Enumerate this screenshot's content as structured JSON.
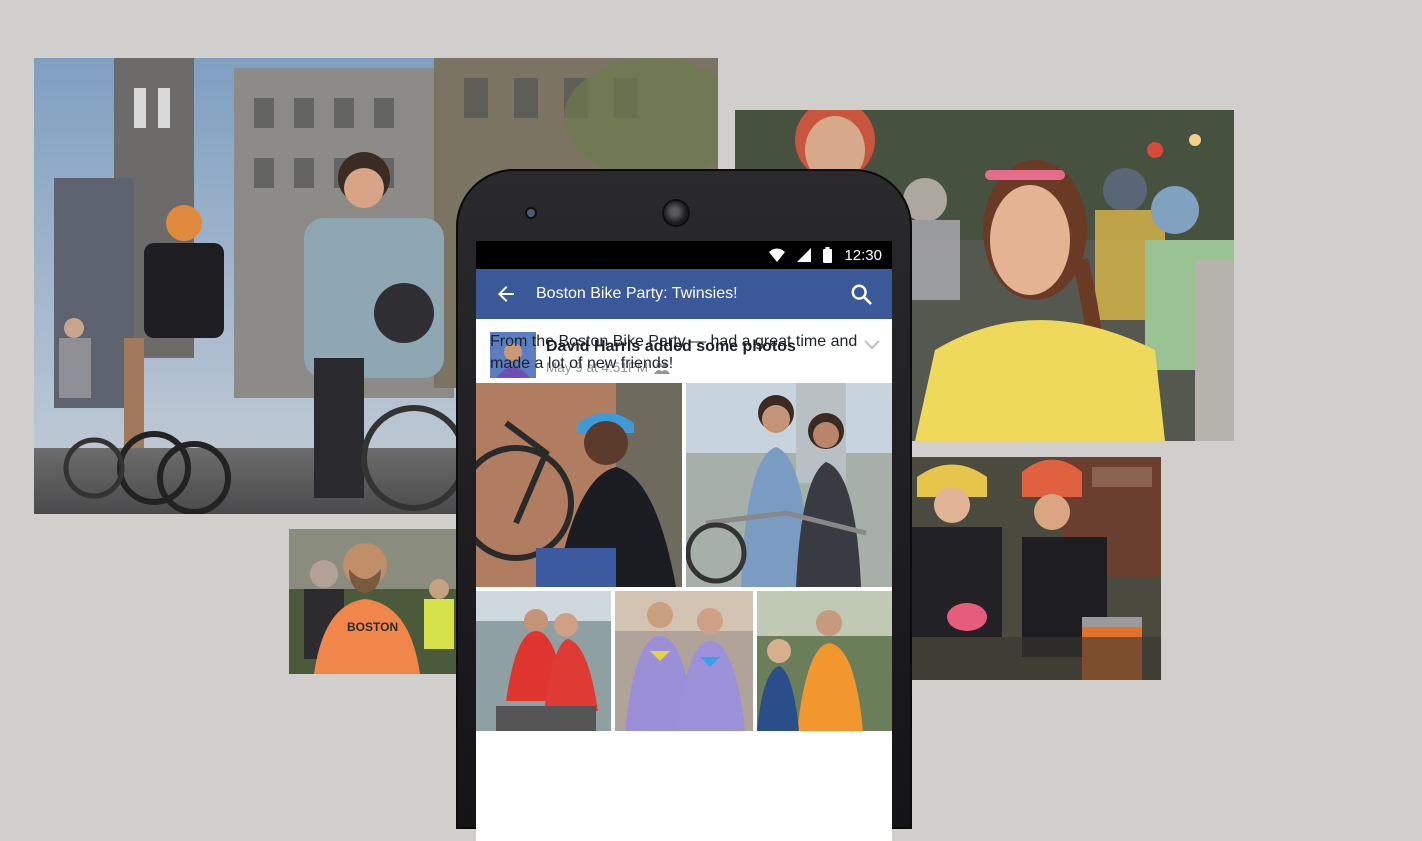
{
  "status_bar": {
    "time": "12:30",
    "icons": [
      "wifi-icon",
      "cell-signal-icon",
      "battery-icon"
    ]
  },
  "app_bar": {
    "title": "Boston Bike Party: Twinsies!",
    "back_icon": "arrow-left-icon",
    "search_icon": "search-icon",
    "color": "#3b5998"
  },
  "post": {
    "author_line": "David Harris added some photos",
    "timestamp": "May 9 at 4:51PM",
    "privacy_icon": "friends-icon",
    "text": "From the Boston Bike Party — had a great time and made a lot of new friends!"
  },
  "photos": {
    "orange_shirt_text": "BOSTON"
  }
}
